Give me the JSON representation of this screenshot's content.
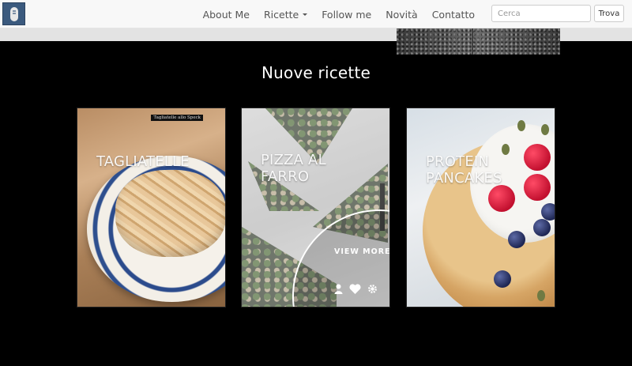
{
  "navbar": {
    "links": [
      {
        "label": "About Me"
      },
      {
        "label": "Ricette",
        "has_caret": true
      },
      {
        "label": "Follow me"
      },
      {
        "label": "Novità"
      },
      {
        "label": "Contatto"
      }
    ],
    "search": {
      "placeholder": "Cerca",
      "button": "Trova"
    }
  },
  "section": {
    "title": "Nuove ricette"
  },
  "cards": [
    {
      "title": "Tagliatelle",
      "tag": "Tagliatelle allo Speck"
    },
    {
      "title": "Pizza al farro",
      "view_more": "VIEW MORE",
      "icons": [
        "user-icon",
        "heart-icon",
        "gear-icon"
      ]
    },
    {
      "title": "Protein pancakes"
    }
  ],
  "colors": {
    "background": "#000000",
    "navbar": "#f8f8f8",
    "logo": "#3b5a7e"
  }
}
